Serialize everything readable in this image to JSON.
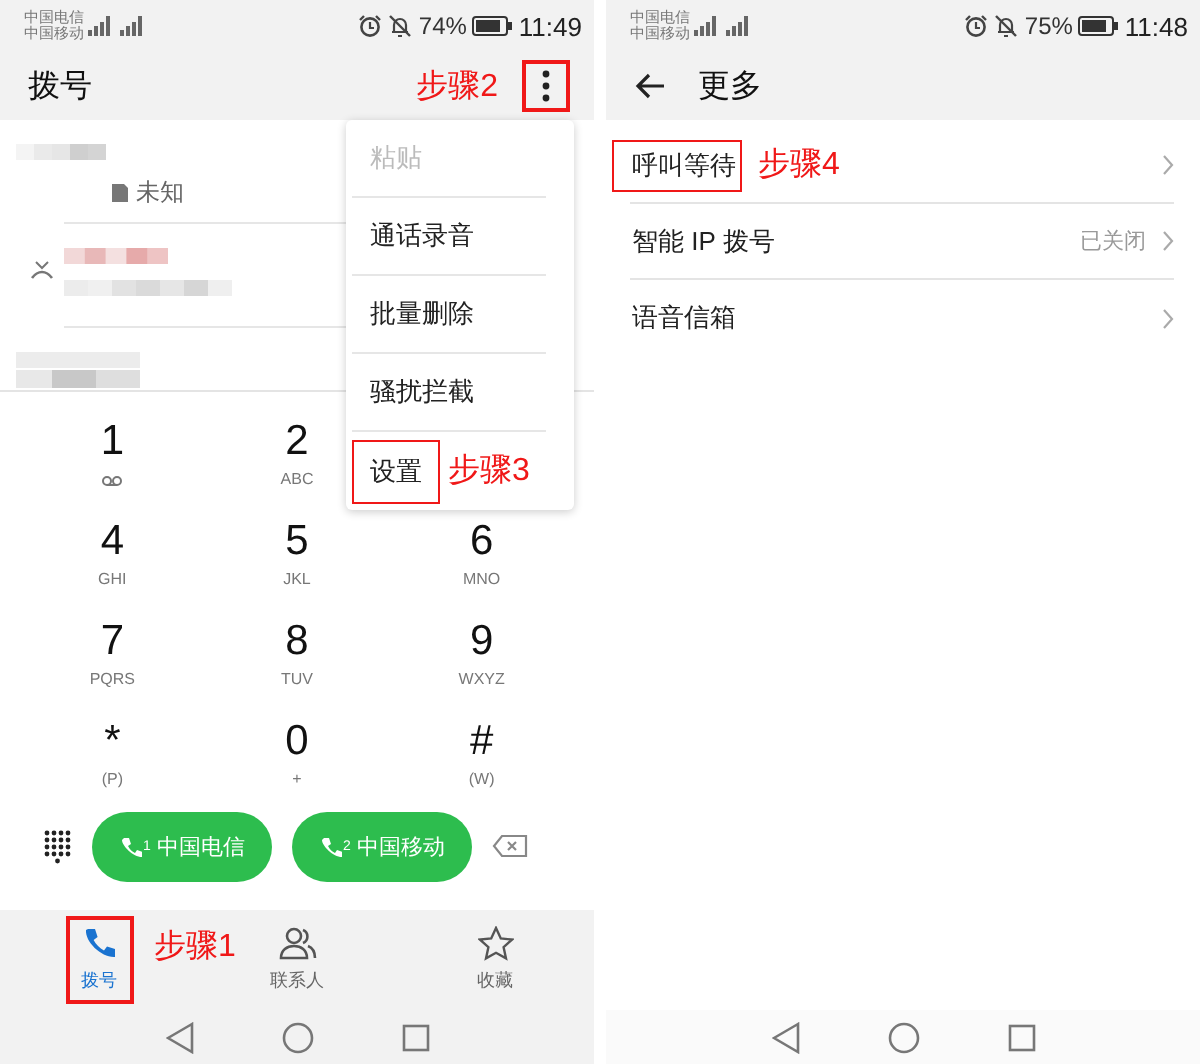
{
  "left_screen": {
    "status_bar": {
      "carriers": [
        "中国电信",
        "中国移动"
      ],
      "battery": "74%",
      "time": "11:49"
    },
    "title": "拨号",
    "menu_button": {
      "highlighted": true,
      "step": "步骤2"
    },
    "call_log": [
      {
        "kind": "unknown",
        "label": "未知"
      },
      {
        "kind": "missed"
      },
      {
        "kind": "plain"
      }
    ],
    "menu": [
      {
        "label": "粘贴",
        "disabled": true,
        "highlighted": false
      },
      {
        "label": "通话录音",
        "disabled": false,
        "highlighted": false
      },
      {
        "label": "批量删除",
        "disabled": false,
        "highlighted": false
      },
      {
        "label": "骚扰拦截",
        "disabled": false,
        "highlighted": false
      },
      {
        "label": "设置",
        "disabled": false,
        "highlighted": true,
        "step": "步骤3"
      }
    ],
    "keypad_rows": [
      {
        "keys": [
          {
            "digit": "1",
            "kind": "voicemail"
          },
          {
            "digit": "2",
            "letters": "ABC"
          }
        ]
      },
      {
        "keys": [
          {
            "digit": "4",
            "letters": "GHI"
          },
          {
            "digit": "5",
            "letters": "JKL"
          },
          {
            "digit": "6",
            "letters": "MNO"
          }
        ]
      },
      {
        "keys": [
          {
            "digit": "7",
            "letters": "PQRS"
          },
          {
            "digit": "8",
            "letters": "TUV"
          },
          {
            "digit": "9",
            "letters": "WXYZ"
          }
        ]
      },
      {
        "keys": [
          {
            "digit": "*",
            "letters": "(P)"
          },
          {
            "digit": "0",
            "letters": "+"
          },
          {
            "digit": "#",
            "letters": "(W)"
          }
        ]
      }
    ],
    "call_buttons": [
      {
        "sim": "1",
        "label": "中国电信"
      },
      {
        "sim": "2",
        "label": "中国移动"
      }
    ],
    "tabs": [
      {
        "kind": "phone",
        "label": "拨号",
        "selected": true,
        "highlighted": true,
        "step": "步骤1"
      },
      {
        "kind": "contacts",
        "label": "联系人",
        "selected": false,
        "highlighted": false
      },
      {
        "kind": "star",
        "label": "收藏",
        "selected": false,
        "highlighted": false
      }
    ]
  },
  "right_screen": {
    "status_bar": {
      "carriers": [
        "中国电信",
        "中国移动"
      ],
      "battery": "75%",
      "time": "11:48"
    },
    "title": "更多",
    "settings": [
      {
        "label": "呼叫等待",
        "highlighted": true,
        "step": "步骤4"
      },
      {
        "label": "智能 IP 拨号",
        "value": "已关闭",
        "highlighted": false
      },
      {
        "label": "语音信箱",
        "highlighted": false
      }
    ]
  }
}
